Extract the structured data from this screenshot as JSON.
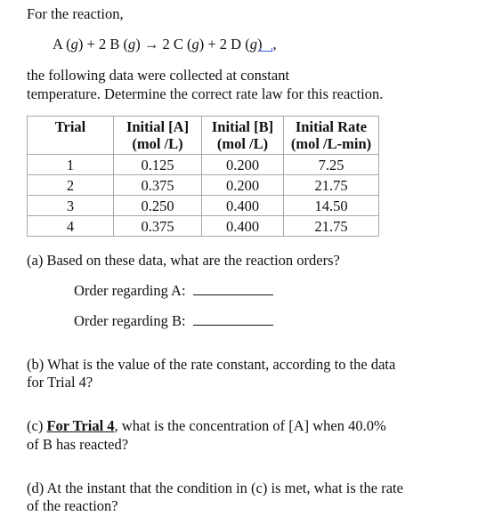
{
  "intro": "For the reaction,",
  "equation": {
    "reactant_a": "A",
    "plus1": "+ 2 B",
    "arrow": "→ 2 C",
    "plus2": "+ 2 D",
    "state": "g",
    "trailing": ","
  },
  "description_line1": "the following data were collected at constant",
  "description_line2": "temperature.  Determine the correct rate law for this reaction.",
  "table": {
    "headers": [
      {
        "line1": "Trial",
        "line2": ""
      },
      {
        "line1": "Initial [A]",
        "line2": "(mol /L)"
      },
      {
        "line1": "Initial [B]",
        "line2": "(mol /L)"
      },
      {
        "line1": "Initial Rate",
        "line2": "(mol /L-min)"
      }
    ],
    "rows": [
      {
        "trial": "1",
        "a": "0.125",
        "b": "0.200",
        "rate": "7.25"
      },
      {
        "trial": "2",
        "a": "0.375",
        "b": "0.200",
        "rate": "21.75"
      },
      {
        "trial": "3",
        "a": "0.250",
        "b": "0.400",
        "rate": "14.50"
      },
      {
        "trial": "4",
        "a": "0.375",
        "b": "0.400",
        "rate": "21.75"
      }
    ]
  },
  "questions": {
    "a": "(a)  Based on these data, what are the reaction orders?",
    "a_order_a": "Order regarding A:",
    "a_order_b": "Order regarding B:",
    "b_line1": "(b)  What is the value of the rate constant, according to the data",
    "b_line2": "for Trial 4?",
    "c_prefix": "(c)  ",
    "c_emphasis": "For Trial 4",
    "c_rest": ", what is the concentration of [A] when 40.0%",
    "c_line2": "of B has reacted?",
    "d_line1": "(d)  At the instant that the condition in (c) is met, what is the rate",
    "d_line2": "of the reaction?"
  }
}
